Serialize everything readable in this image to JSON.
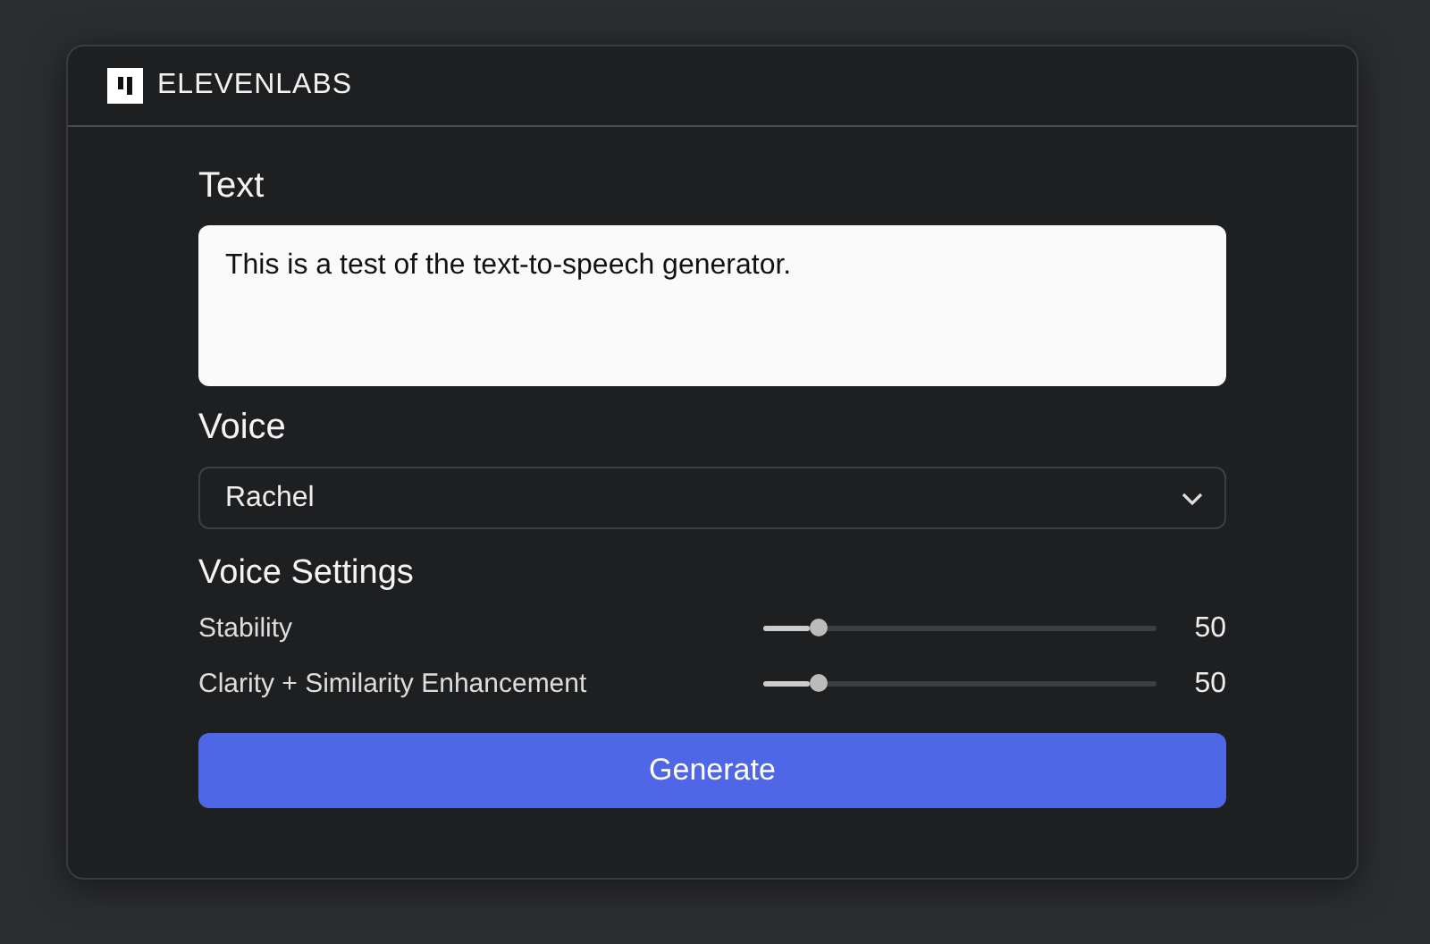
{
  "header": {
    "brand": "ELEVENLABS"
  },
  "text_section": {
    "label": "Text",
    "value": "This is a test of the text-to-speech generator."
  },
  "voice_section": {
    "label": "Voice",
    "value": "Rachel"
  },
  "settings": {
    "title": "Voice Settings",
    "sliders": [
      {
        "name": "Stability",
        "level": 0.14,
        "reading": "50"
      },
      {
        "name": "Clarity + Similarity Enhancement",
        "level": 0.14,
        "reading": "50"
      }
    ]
  },
  "button": "Generate"
}
